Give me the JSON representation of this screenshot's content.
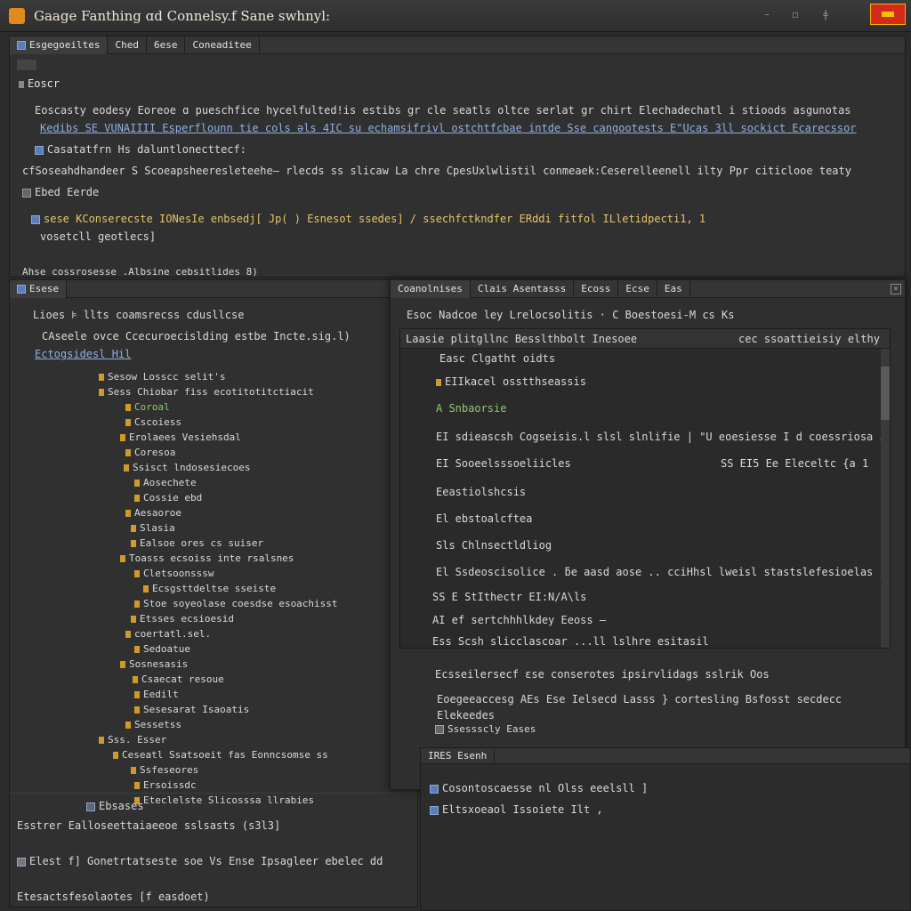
{
  "app": {
    "title": "Gaage Fanthing ɑd Connelsy.f Sane swhnyl:"
  },
  "top_panel": {
    "tabs": [
      "Esgegoeiltes",
      "Ched",
      "6ese",
      "Coneaditee"
    ],
    "label": "Eoscr",
    "lines": [
      "Eoscasty eodesy Eoreoe  ɑ pueschfice hycelfulted!is estibs gr  cle seatls oltce serlat  gr chirt  Elechadechatl i stioods asgunotas",
      "Kedibs  SE VUNAIIII  Esperflounn  tie cols ǝls 4IC  su  echamsifrivl  ostchtfcbae intde  Sse  cangootests  E\"Ucas 3ll  sockict  Ecarecssor",
      "Casatatfrn  Hs  daluntlonecttecf:",
      "cfSoseahdhandeer  S  Scoeapsheeresleteehe—  rlecds  ss  slicaw  La  chre  CpesUxlwlistil  conmeaek:Ceserelleenell  ilty  Ppr  citiclooe  teaty",
      "Ebed  Eerde",
      "sese  KConserecste  IONesIe  enbsedj[  Jp(  )  Esnesot  ssedes]  /  ssechfctkndfer  ERddi  fitfol  ILletidpecti1,  1",
      "vosetcll  geotlecs]",
      "Ahse  cossrosesse  .Albsine  cebsitlides  8)"
    ]
  },
  "left_panel": {
    "header": "Esese",
    "top_lines": [
      "Lioes  ⊧  llts  coamsrecss  cdusllcse",
      "CAseele  ovce  Ccecuroecislding  estbe  Incte.sig.l)",
      "Ectogsidesl  Hil"
    ],
    "tree": [
      "Sesow  Losscc  selit's",
      "Sess  Chiobar  fiss  ecotitotitctiacit",
      "Coroal",
      "Cscoiess",
      "Erolaees  Vesiehsdal",
      "Coresoa",
      "Ssisct  lndosesiecoes",
      "Aosechete",
      "Cossie  ebd",
      "Aesaoroe",
      "Slasia",
      "Ealsoe  ores  cs  suiser",
      "Toasss  ecsoiss  inte  rsalsnes",
      "Cletsoonsssw",
      "Ecsgsttdeltse  sseiste",
      "Stoe  soyeolase  coesdse  esoachisst",
      "Etsses  ecsioesid",
      "coertatl.sel.",
      "Sedoatue",
      "Sosnesasis",
      "Csaecat  resoue",
      "Eedilt",
      "Sesesarat  Isaoatis",
      "Sessetss",
      "Sss.  Esser",
      "Ceseatl  Ssatsoeit  fas  Eonncsomse  ss",
      "Ssfeseores",
      "Ersoissdc",
      "Eteclelste  Slicosssa  llrabies"
    ],
    "footer_lines": [
      "Ebsases",
      "Esstrer  Ealloseettaiaeeoe  sslsasts  (s3l3]",
      "Elest  f]  Gonetrtatseste  soe  Vs  Ense  Ipsagleer  ebelec  dd",
      "Etesactsfesolaotes  [f  easdoet)"
    ]
  },
  "dialog": {
    "tabs": [
      "Coanolnises",
      "Clais  Asentasss",
      "Ecoss",
      "Ecse",
      "Eas"
    ],
    "close_icon": "close-icon",
    "subheader": "Esoc  Nadcoe  ley  Lrelocsolitis  ·  C  Boestoesi-M  cs  Ks",
    "columns": [
      "Laasie  plitgllnc  Besslthbolt  Inesoee",
      "cec  ssoattieisiy  elthy"
    ],
    "rows": [
      "Easc  Clgatht  oidts",
      "EIIkacel  osstthseassis",
      "A  Snbaorsie",
      "EI  sdieascsh  Cogseisis.l  slsl  slnlifie  |  \"U  eoesiesse  I  d  coessriosa  i",
      "EI  Sooeelsssoeliicles",
      "Eeastiolshcsis",
      "El  ebstoalcftea",
      "Sls  Chlnsectldliog",
      "El  Ssdeoscisolice  .  ƃe  aasd  aose  ..  cciHhsl  lweisl  stastslefesioelas  }",
      "SS  E  StIthectr  EI:N/A\\ls",
      "AI  ef  sertchhhlkdey  Eeoss  —",
      "Ess  Scsh  slicclascoar  ...ll  lslhre  esitasil"
    ],
    "trail_right_1": "SS  EI5  Ee  Eleceltc  {a  1",
    "bottom_lines": [
      "Ecsseilersecf  ɛse  conserotes  ipsirvlidags  sslrik  Oos",
      "Eoegeeaccesg  AEs  Ese  Ielsecd  Lasss  }  cortesling  Bsfosst  secdecc",
      "Elekeedes",
      "Ssessscly  Eases"
    ]
  },
  "right_bottom": {
    "header": "IRES  Esenh",
    "lines": [
      "Cosontoscaesse  nl  Olss  eeelsll  ]",
      "Eltsxoeaol  Issoiete  Ilt  ,"
    ]
  }
}
